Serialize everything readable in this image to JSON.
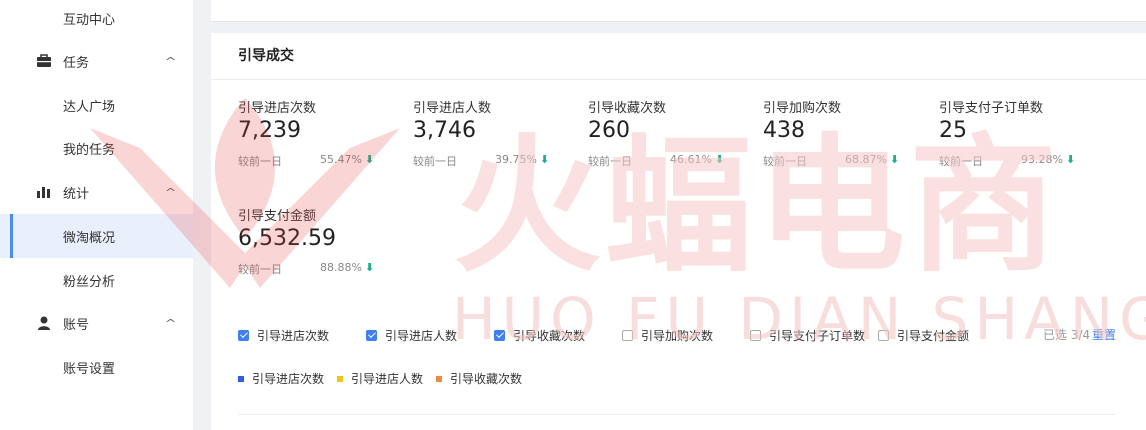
{
  "sidebar": {
    "items": [
      {
        "label": "互动中心",
        "type": "sub"
      },
      {
        "label": "任务",
        "type": "group",
        "icon": "briefcase-icon"
      },
      {
        "label": "达人广场",
        "type": "sub"
      },
      {
        "label": "我的任务",
        "type": "sub"
      },
      {
        "label": "统计",
        "type": "group",
        "icon": "bar-chart-icon"
      },
      {
        "label": "微淘概况",
        "type": "sub",
        "active": true
      },
      {
        "label": "粉丝分析",
        "type": "sub"
      },
      {
        "label": "账号",
        "type": "group",
        "icon": "user-icon"
      },
      {
        "label": "账号设置",
        "type": "sub"
      }
    ],
    "chevron": "^"
  },
  "card": {
    "title": "引导成交"
  },
  "metrics": [
    {
      "label": "引导进店次数",
      "value": "7,239",
      "compare": "较前一日",
      "pct": "55.47%",
      "trend": "down"
    },
    {
      "label": "引导进店人数",
      "value": "3,746",
      "compare": "较前一日",
      "pct": "39.75%",
      "trend": "down"
    },
    {
      "label": "引导收藏次数",
      "value": "260",
      "compare": "较前一日",
      "pct": "46.61%",
      "trend": "down"
    },
    {
      "label": "引导加购次数",
      "value": "438",
      "compare": "较前一日",
      "pct": "68.87%",
      "trend": "down"
    },
    {
      "label": "引导支付子订单数",
      "value": "25",
      "compare": "较前一日",
      "pct": "93.28%",
      "trend": "down"
    },
    {
      "label": "引导支付金额",
      "value": "6,532.59",
      "compare": "较前一日",
      "pct": "88.88%",
      "trend": "down"
    }
  ],
  "arrow_glyph": "⬇",
  "checkboxes": [
    {
      "label": "引导进店次数",
      "checked": true
    },
    {
      "label": "引导进店人数",
      "checked": true
    },
    {
      "label": "引导收藏次数",
      "checked": true
    },
    {
      "label": "引导加购次数",
      "checked": false
    },
    {
      "label": "引导支付子订单数",
      "checked": false
    },
    {
      "label": "引导支付金额",
      "checked": false
    }
  ],
  "selection": {
    "count_text": "已选 3/4",
    "reset_label": "重置"
  },
  "legend": [
    {
      "label": "引导进店次数",
      "color": "#2f5fe0"
    },
    {
      "label": "引导进店人数",
      "color": "#f0c419"
    },
    {
      "label": "引导收藏次数",
      "color": "#f08a3c"
    }
  ],
  "watermark": {
    "big": "火蝠电商",
    "small": "HUO FU DIAN SHANG"
  },
  "colors": {
    "accent": "#3f7ff0",
    "down": "#1aad8f",
    "watermark": "#f4c3c3"
  }
}
